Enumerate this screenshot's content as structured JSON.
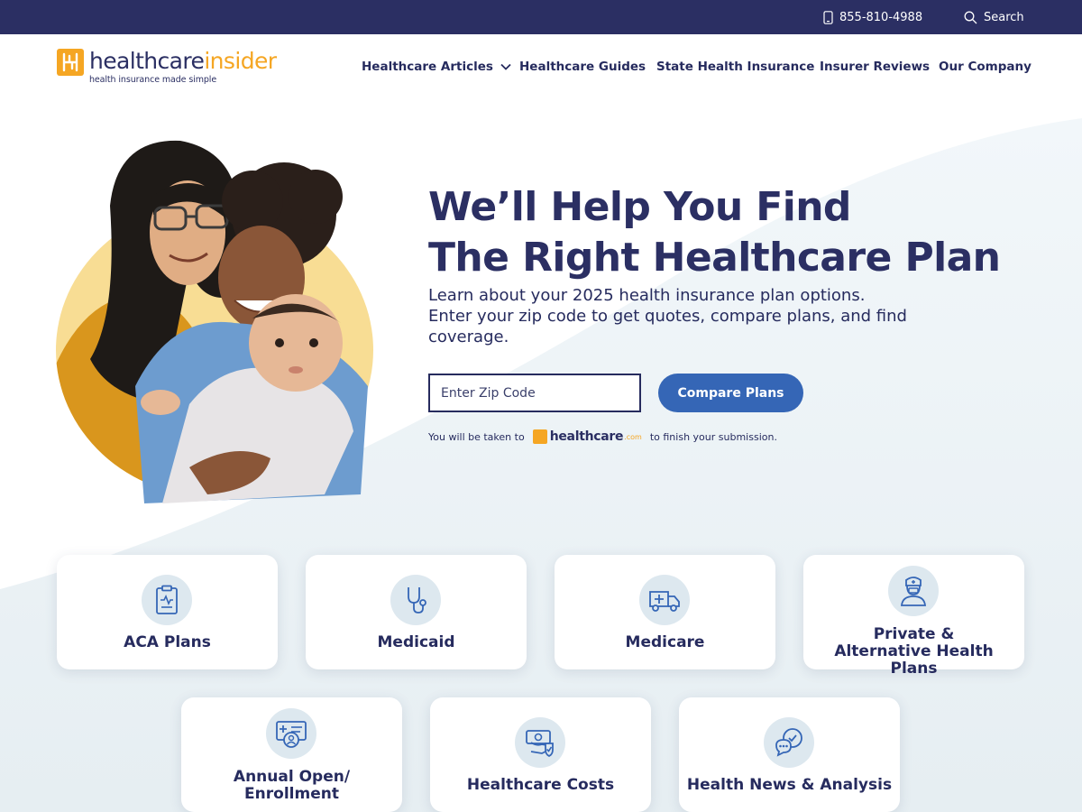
{
  "topbar": {
    "phone": "855-810-4988",
    "phone_icon": "phone-icon",
    "search_label": "Search",
    "search_icon": "search-icon"
  },
  "logo": {
    "name_part1": "healthcare",
    "name_part2": "insider",
    "tagline": "health insurance made simple"
  },
  "nav": {
    "items": [
      {
        "label": "Healthcare Articles",
        "has_dropdown": true
      },
      {
        "label": "Healthcare Guides"
      },
      {
        "label": "State Health Insurance"
      },
      {
        "label": "Insurer Reviews"
      },
      {
        "label": "Our Company"
      }
    ]
  },
  "hero": {
    "title_line1": "We’ll Help You Find",
    "title_line2": "The Right Healthcare Plan",
    "subtitle_line1": "Learn about your 2025 health insurance plan options.",
    "subtitle_line2": "Enter your zip code to get quotes, compare plans, and find coverage.",
    "zip_placeholder": "Enter Zip Code",
    "zip_value": "",
    "cta_label": "Compare Plans",
    "note_before": "You will be taken to",
    "partner_name": "healthcare",
    "partner_suffix": ".com",
    "note_after": "to finish your submission."
  },
  "cards": [
    {
      "label": "ACA Plans",
      "icon": "clipboard-icon"
    },
    {
      "label": "Medicaid",
      "icon": "stethoscope-icon"
    },
    {
      "label": "Medicare",
      "icon": "ambulance-icon"
    },
    {
      "label": "Private & Alternative Health Plans",
      "icon": "doctor-icon"
    },
    {
      "label": "Annual Open/ Enrollment",
      "icon": "id-card-icon"
    },
    {
      "label": "Healthcare Costs",
      "icon": "money-shield-icon"
    },
    {
      "label": "Health News & Analysis",
      "icon": "chat-bubbles-icon"
    }
  ],
  "colors": {
    "navy": "#2b2f63",
    "accent_orange": "#f5a623",
    "button_blue": "#3566b6",
    "hero_circle_yellow": "#f8dd94",
    "icon_circle": "#dde8ef"
  }
}
